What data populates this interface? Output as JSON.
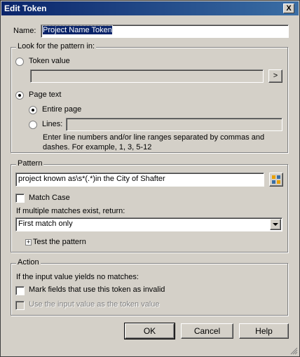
{
  "window": {
    "title": "Edit Token",
    "close_label": "X"
  },
  "name": {
    "label": "Name:",
    "value": "Project Name Token"
  },
  "look_group": {
    "legend": "Look for the pattern in:",
    "token_value_label": "Token value",
    "browse_label": ">",
    "page_text_label": "Page text",
    "entire_page_label": "Entire page",
    "lines_label": "Lines:",
    "hint_line1": "Enter line numbers and/or line ranges separated by commas and",
    "hint_line2": "dashes.  For example, 1, 3, 5-12"
  },
  "pattern_group": {
    "legend": "Pattern",
    "pattern_value": "project known as\\s*(.*)in the City of Shafter",
    "match_case_label": "Match Case",
    "multiple_label": "If multiple matches exist, return:",
    "multiple_selected": "First match only",
    "test_label": "Test the pattern"
  },
  "action_group": {
    "legend": "Action",
    "no_match_label": "If the input value yields no matches:",
    "mark_invalid_label": "Mark fields that use this token as invalid",
    "use_input_label": "Use the input value as the token value"
  },
  "buttons": {
    "ok": "OK",
    "cancel": "Cancel",
    "help": "Help"
  }
}
